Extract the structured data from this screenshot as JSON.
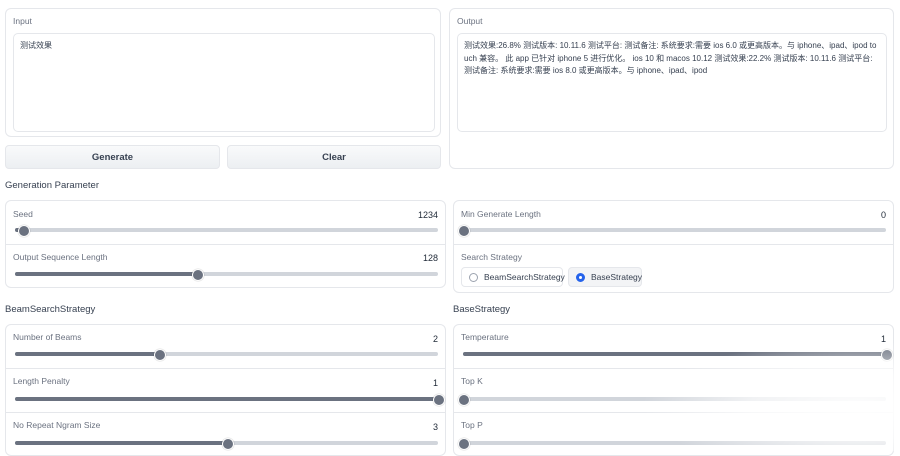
{
  "input": {
    "label": "Input",
    "value": "测试效果"
  },
  "output": {
    "label": "Output",
    "value": "测试效果:26.8% 测试版本: 10.11.6 测试平台: 测试备注: 系统要求:需要 ios 6.0 或更高版本。与 iphone、ipad、ipod touch 兼容。 此 app 已针对 iphone 5 进行优化。 ios 10 和 macos 10.12 测试效果:22.2% 测试版本: 10.11.6 测试平台: 测试备注: 系统要求:需要 ios 8.0 或更高版本。与 iphone、ipad、ipod"
  },
  "buttons": {
    "generate": "Generate",
    "clear": "Clear"
  },
  "generation_parameter": {
    "title": "Generation Parameter",
    "seed": {
      "label": "Seed",
      "value": "1234",
      "fraction": 0.02
    },
    "output_sequence_length": {
      "label": "Output Sequence Length",
      "value": "128",
      "fraction": 0.43
    },
    "min_generate_length": {
      "label": "Min Generate Length",
      "value": "0",
      "fraction": 0.0
    },
    "search_strategy": {
      "label": "Search Strategy",
      "options": [
        "BeamSearchStrategy",
        "BaseStrategy"
      ],
      "selected": "BaseStrategy"
    }
  },
  "beam_search_strategy": {
    "title": "BeamSearchStrategy",
    "number_of_beams": {
      "label": "Number of Beams",
      "value": "2",
      "fraction": 0.34
    },
    "length_penalty": {
      "label": "Length Penalty",
      "value": "1",
      "fraction": 1.0
    },
    "no_repeat_ngram_size": {
      "label": "No Repeat Ngram Size",
      "value": "3",
      "fraction": 0.5
    }
  },
  "base_strategy": {
    "title": "BaseStrategy",
    "temperature": {
      "label": "Temperature",
      "value": "1",
      "fraction": 1.0
    },
    "top_k": {
      "label": "Top K",
      "value": "",
      "fraction": 0.0
    },
    "top_p": {
      "label": "Top P",
      "value": "",
      "fraction": 0.0
    }
  },
  "colors": {
    "accent": "#2563eb",
    "slider": "#6b7280",
    "track": "#d1d5db",
    "border": "#e5e7eb"
  }
}
